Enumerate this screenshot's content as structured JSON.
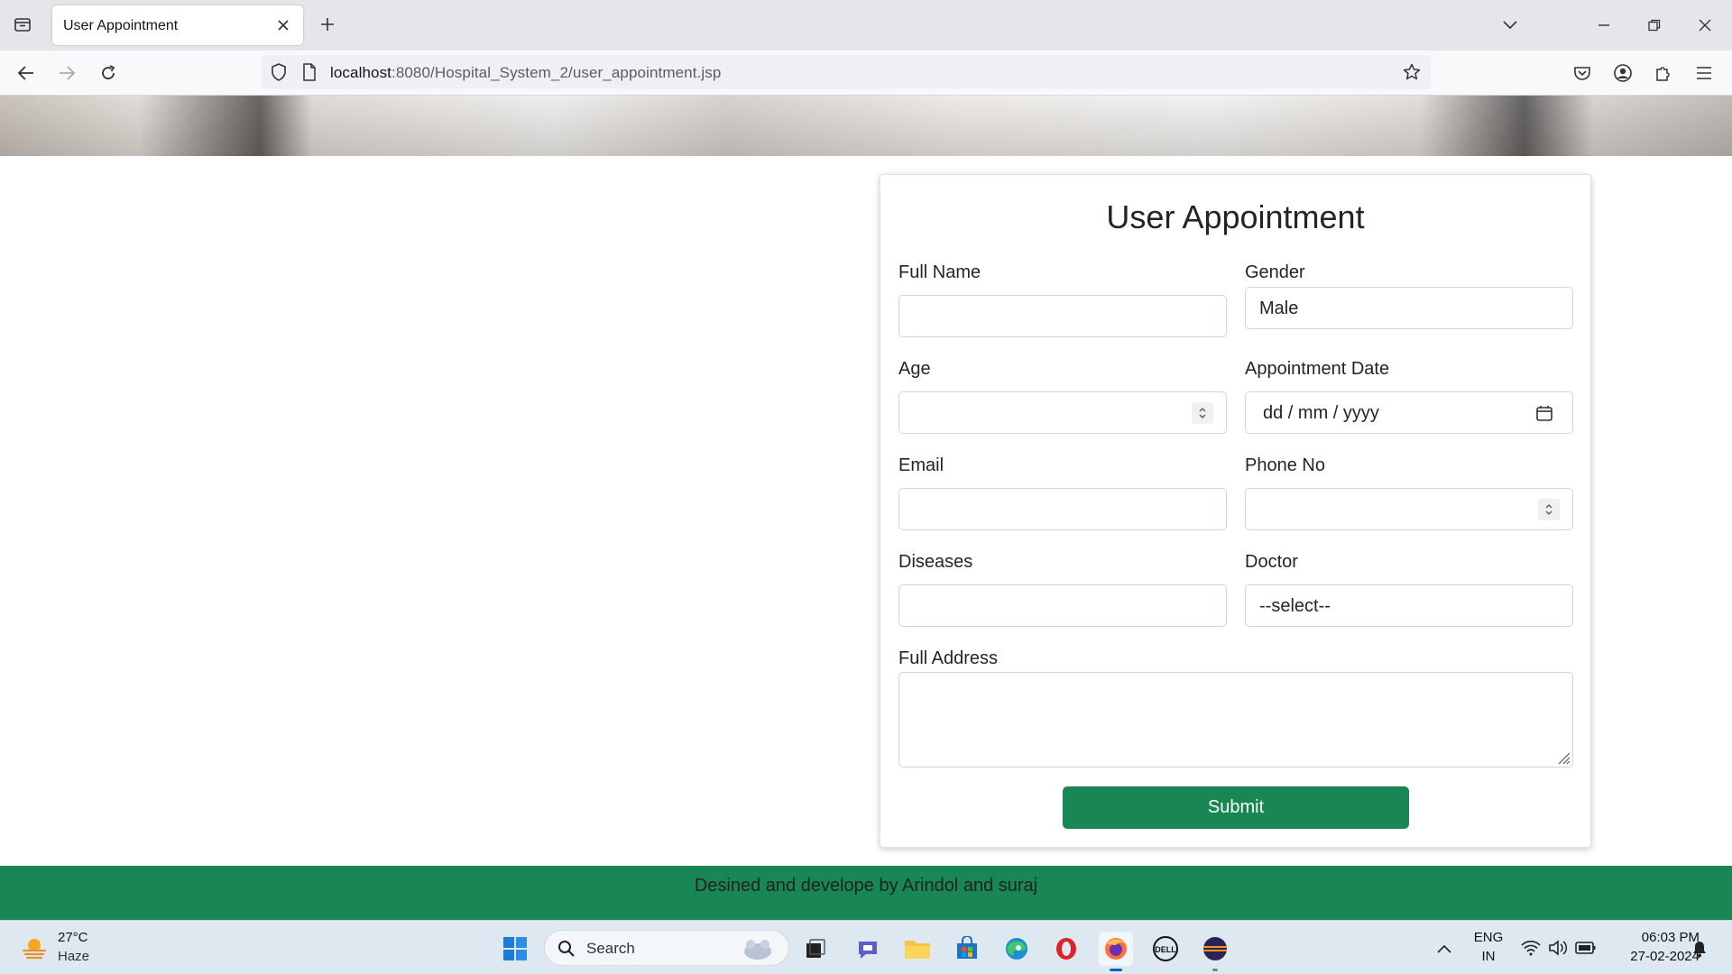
{
  "browser": {
    "tab_title": "User Appointment",
    "url_host": "localhost",
    "url_path": ":8080/Hospital_System_2/user_appointment.jsp"
  },
  "form": {
    "title": "User Appointment",
    "full_name": {
      "label": "Full Name",
      "value": ""
    },
    "gender": {
      "label": "Gender",
      "value": "Male"
    },
    "age": {
      "label": "Age",
      "value": ""
    },
    "appointment_date": {
      "label": "Appointment Date",
      "placeholder": "dd / mm / yyyy"
    },
    "email": {
      "label": "Email",
      "value": ""
    },
    "phone": {
      "label": "Phone No",
      "value": ""
    },
    "diseases": {
      "label": "Diseases",
      "value": ""
    },
    "doctor": {
      "label": "Doctor",
      "value": "--select--"
    },
    "address": {
      "label": "Full Address",
      "value": ""
    },
    "submit_label": "Submit"
  },
  "footer": {
    "text": "Desined and develope by Arindol and suraj"
  },
  "taskbar": {
    "weather_temp": "27°C",
    "weather_desc": "Haze",
    "search_label": "Search",
    "lang_top": "ENG",
    "lang_bottom": "IN",
    "time": "06:03 PM",
    "date": "27-02-2024"
  },
  "colors": {
    "primary_green": "#198754",
    "taskbar": "#dde8f0"
  }
}
